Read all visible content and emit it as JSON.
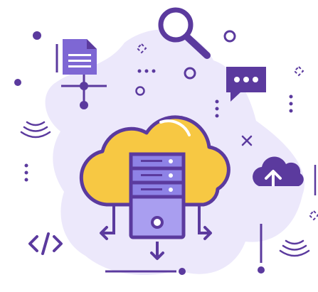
{
  "illustration": {
    "icons": [
      "network-document-icon",
      "magnifier-icon",
      "chat-bubble-icon",
      "cloud-server-icon",
      "cloud-sync-icon",
      "code-tag-icon",
      "wifi-signal-icon",
      "close-icon",
      "download-arrow-icon"
    ]
  },
  "colors": {
    "primary": "#5b3a9e",
    "blob": "#ece8fb",
    "cloud": "#f7c843",
    "server_light": "#a99ef0",
    "server_mid": "#8e82e6",
    "white": "#ffffff"
  }
}
